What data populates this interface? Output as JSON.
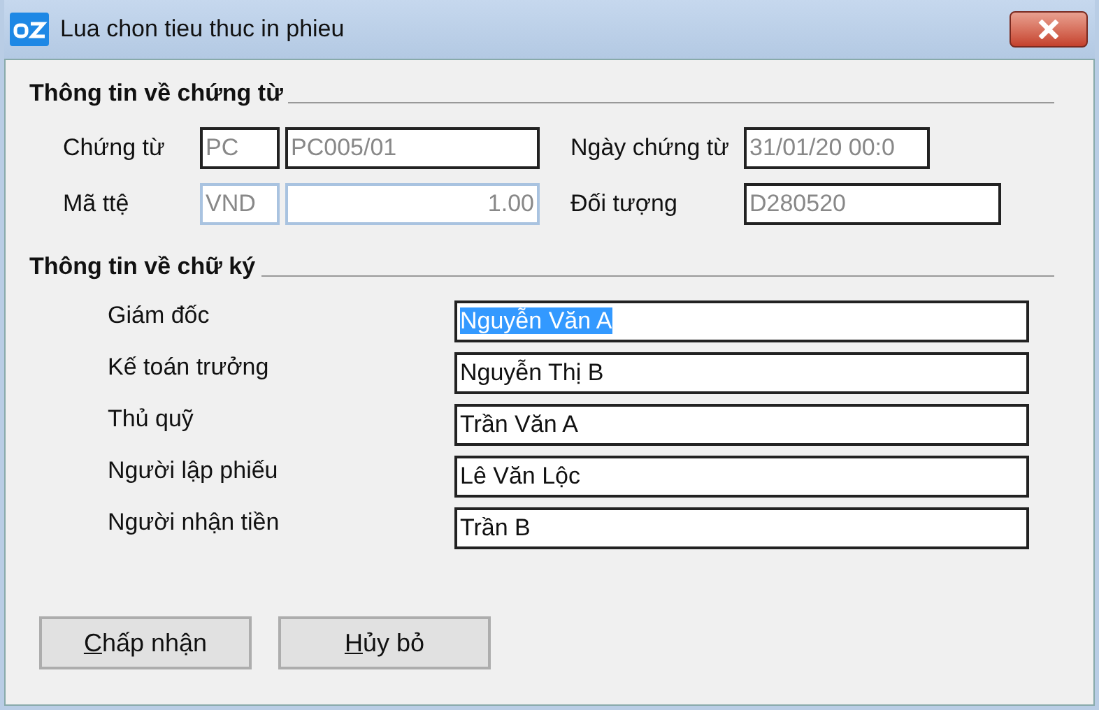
{
  "window": {
    "title": "Lua chon tieu thuc in phieu"
  },
  "document_section": {
    "heading": "Thông tin về chứng từ",
    "rows": [
      {
        "label": "Chứng từ",
        "fields": [
          {
            "value": "PC",
            "disabled": false
          },
          {
            "value": "PC005/01",
            "disabled": false
          }
        ],
        "right_label": "Ngày chứng từ",
        "right_field": {
          "value": "31/01/20 00:0",
          "disabled": false
        }
      },
      {
        "label": "Mã ttệ",
        "fields": [
          {
            "value": "VND",
            "disabled": true
          },
          {
            "value": "1.00",
            "disabled": true,
            "kind": "amount"
          }
        ],
        "right_label": "Đối tượng",
        "right_field": {
          "value": "D280520",
          "disabled": false
        }
      }
    ]
  },
  "signature_section": {
    "heading": "Thông tin về chữ ký",
    "rows": [
      {
        "label": "Giám đốc",
        "value": "Nguyễn Văn A",
        "selected": true
      },
      {
        "label": "Kế toán trưởng",
        "value": "Nguyễn Thị B",
        "selected": false
      },
      {
        "label": "Thủ quỹ",
        "value": "Trần Văn A",
        "selected": false
      },
      {
        "label": "Người lập phiếu",
        "value": "Lê Văn Lộc",
        "selected": false
      },
      {
        "label": "Người nhận tiền",
        "value": "Trần B",
        "selected": false
      }
    ]
  },
  "buttons": [
    {
      "label": "Chấp nhận",
      "underline_first": true
    },
    {
      "label": "Hủy bỏ",
      "underline_first": true
    }
  ]
}
